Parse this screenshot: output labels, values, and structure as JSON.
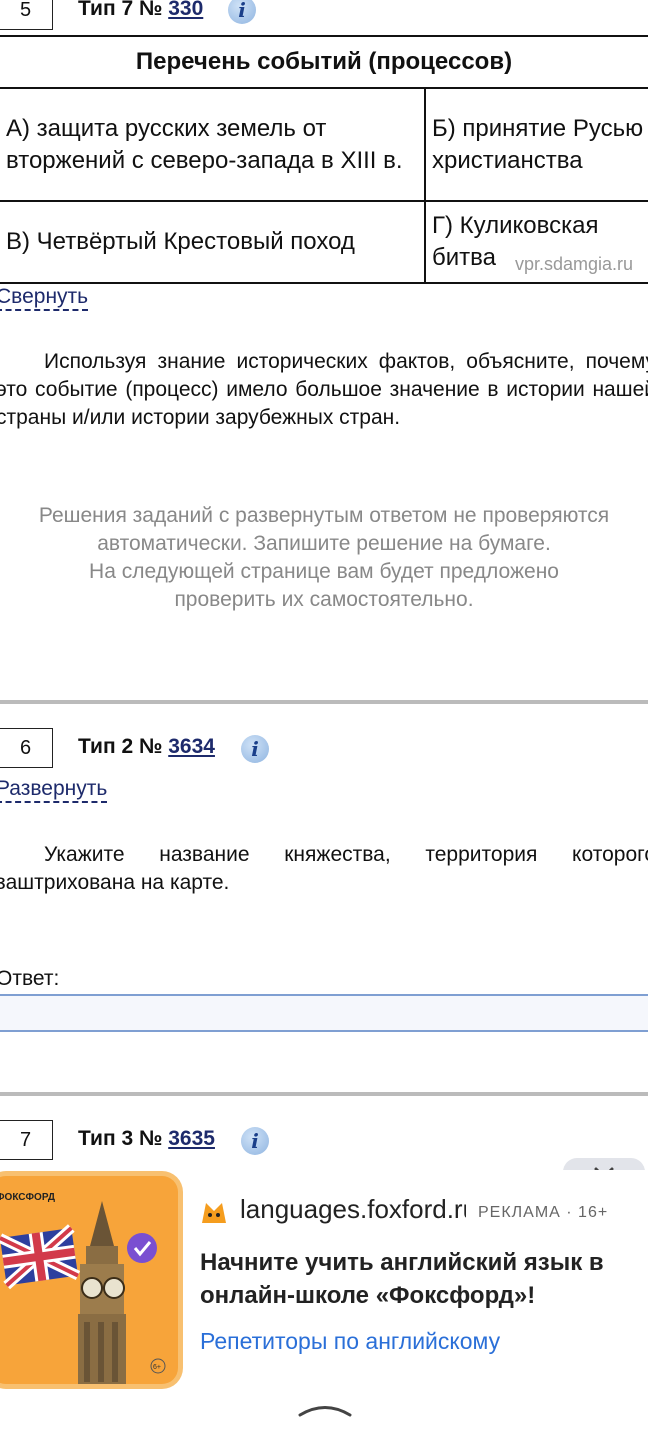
{
  "task5": {
    "number": "5",
    "type_label": "Тип 7 №",
    "id": "330",
    "info": "i",
    "table": {
      "header": "Перечень событий (процессов)",
      "cells": {
        "a": "А) защита русских земель от вторжений с северо-запада в XIII в.",
        "b": "Б) принятие Русью христиан­ства",
        "c": "В) Четвёртый Крестовый поход",
        "d": "Г) Куликовская битва"
      }
    },
    "watermark": "vpr.sdamgia.ru",
    "toggle": "Свернуть",
    "question": "Используя знание исторических фактов, объясните, почему это событие (процесс) имело большое значение в истории нашей страны и/или истории зарубежных стран.",
    "note_line1": "Решения заданий с развернутым ответом не проверяются автоматически. Запишите решение на бумаге.",
    "note_line2": "На следующей странице вам будет предложено проверить их самостоятельно."
  },
  "task6": {
    "number": "6",
    "type_label": "Тип 2 №",
    "id": "3634",
    "info": "i",
    "toggle": "Развернуть",
    "question": "Укажите название княжества, территория которого заштрихована на карте.",
    "answer_label": "Ответ:",
    "answer_value": ""
  },
  "task7": {
    "number": "7",
    "type_label": "Тип 3 №",
    "id": "3635",
    "info": "i"
  },
  "ad": {
    "domain": "languages.foxford.ru",
    "tag": "РЕКЛАМА · 16+",
    "title": "Начните учить английский язык в онлайн-школе «Фоксфорд»!",
    "link": "Репетиторы по английскому",
    "brand": "ФОКСФОРД",
    "age": "6+",
    "close_icon": "close-icon",
    "colors": {
      "thumb": "#f7a43a",
      "link": "#2a6fd8"
    }
  }
}
